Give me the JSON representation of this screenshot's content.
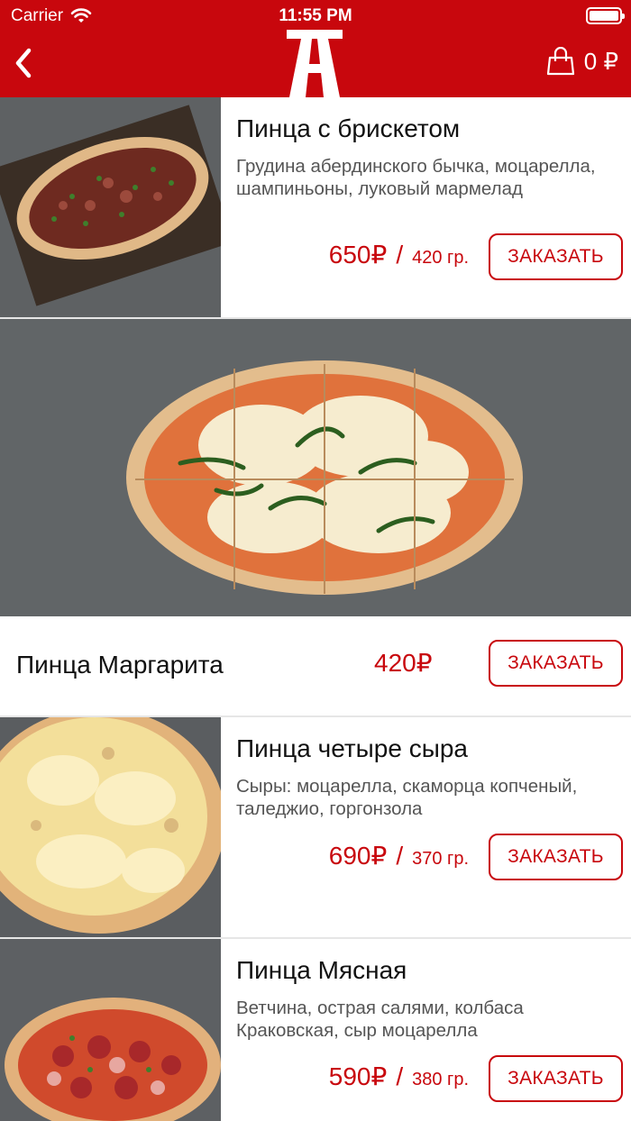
{
  "status_bar": {
    "carrier": "Carrier",
    "time": "11:55 PM"
  },
  "header": {
    "cart_total": "0 ₽"
  },
  "colors": {
    "brand_red": "#c8070d",
    "price_red": "#c8070d",
    "text_gray": "#555555"
  },
  "products": [
    {
      "title": "Пинца с брискетом",
      "description": "Грудина абердинского бычка, моцарелла, шампиньоны, луковый мармелад",
      "price": "650₽",
      "weight": "420 гр.",
      "order_label": "ЗАКАЗАТЬ"
    },
    {
      "title": "Пинца Маргарита",
      "price": "420₽",
      "order_label": "ЗАКАЗАТЬ"
    },
    {
      "title": "Пинца четыре сыра",
      "description": "Сыры: моцарелла, скаморца копченый, таледжио, горгонзола",
      "price": "690₽",
      "weight": "370 гр.",
      "order_label": "ЗАКАЗАТЬ"
    },
    {
      "title": "Пинца Мясная",
      "description": "Ветчина, острая салями, колбаса Краковская, сыр моцарелла",
      "price": "590₽",
      "weight": "380 гр.",
      "order_label": "ЗАКАЗАТЬ"
    }
  ],
  "separator": "/"
}
